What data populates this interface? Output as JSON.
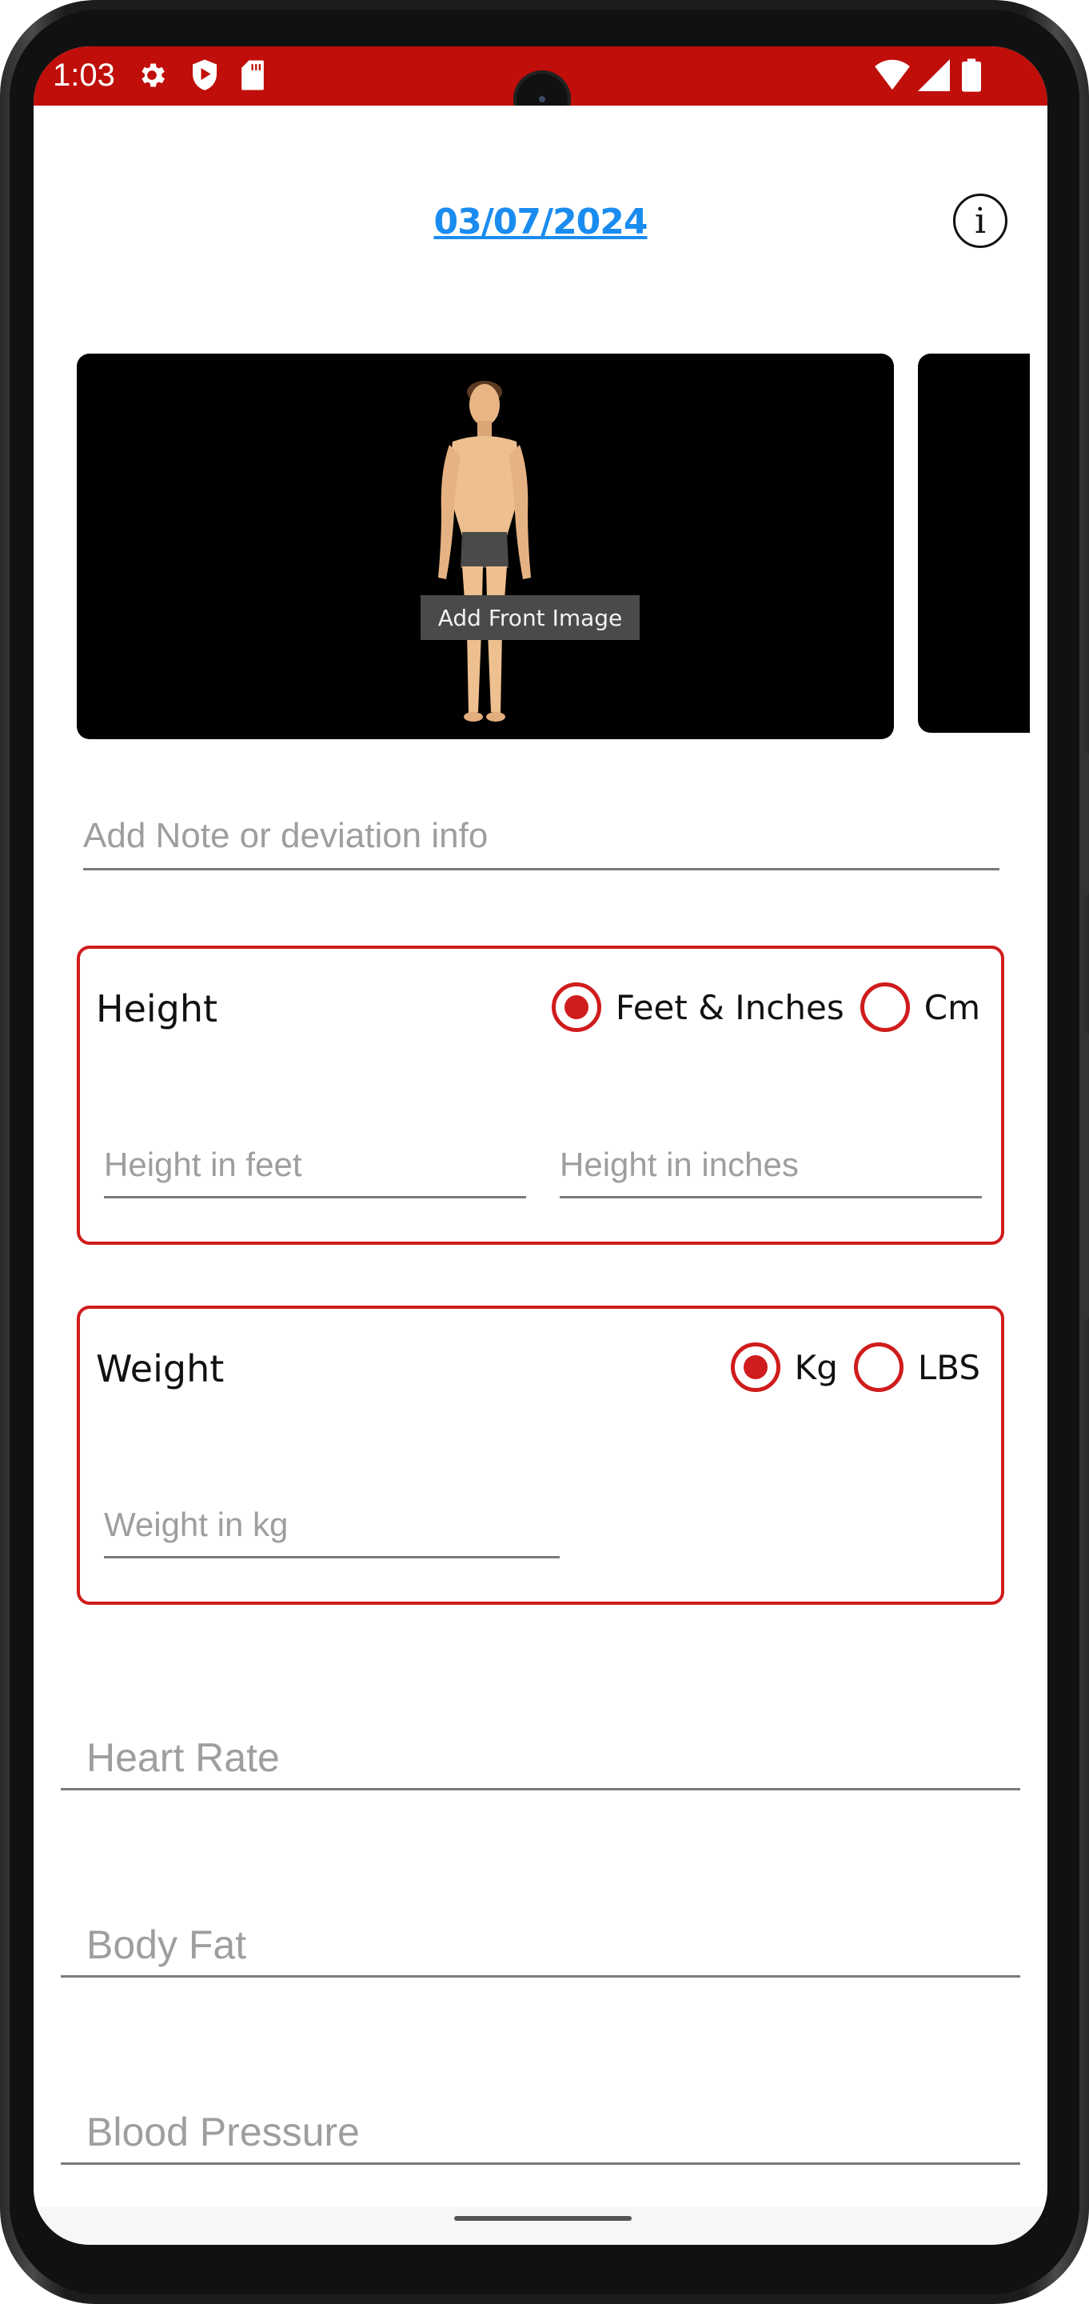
{
  "status_bar": {
    "time": "1:03",
    "left_icons": [
      "gear-icon",
      "shield-play-icon",
      "sd-card-icon"
    ],
    "right_icons": [
      "wifi-icon",
      "cell-signal-icon",
      "battery-icon"
    ],
    "color": "#c00e0a"
  },
  "header": {
    "date": "03/07/2024",
    "info_icon": "info-icon",
    "date_color": "#1a8cef"
  },
  "images": {
    "front_button_label": "Add Front Image"
  },
  "note": {
    "placeholder": "Add Note or deviation info",
    "value": ""
  },
  "height": {
    "title": "Height",
    "options": [
      {
        "label": "Feet & Inches",
        "selected": true
      },
      {
        "label": "Cm",
        "selected": false
      }
    ],
    "feet_placeholder": "Height in feet",
    "inches_placeholder": "Height in inches"
  },
  "weight": {
    "title": "Weight",
    "options": [
      {
        "label": "Kg",
        "selected": true
      },
      {
        "label": "LBS",
        "selected": false
      }
    ],
    "kg_placeholder": "Weight in kg"
  },
  "fields": {
    "heart_rate_placeholder": "Heart Rate",
    "body_fat_placeholder": "Body Fat",
    "blood_pressure_placeholder": "Blood Pressure"
  },
  "theme": {
    "accent": "#d01c1c"
  }
}
